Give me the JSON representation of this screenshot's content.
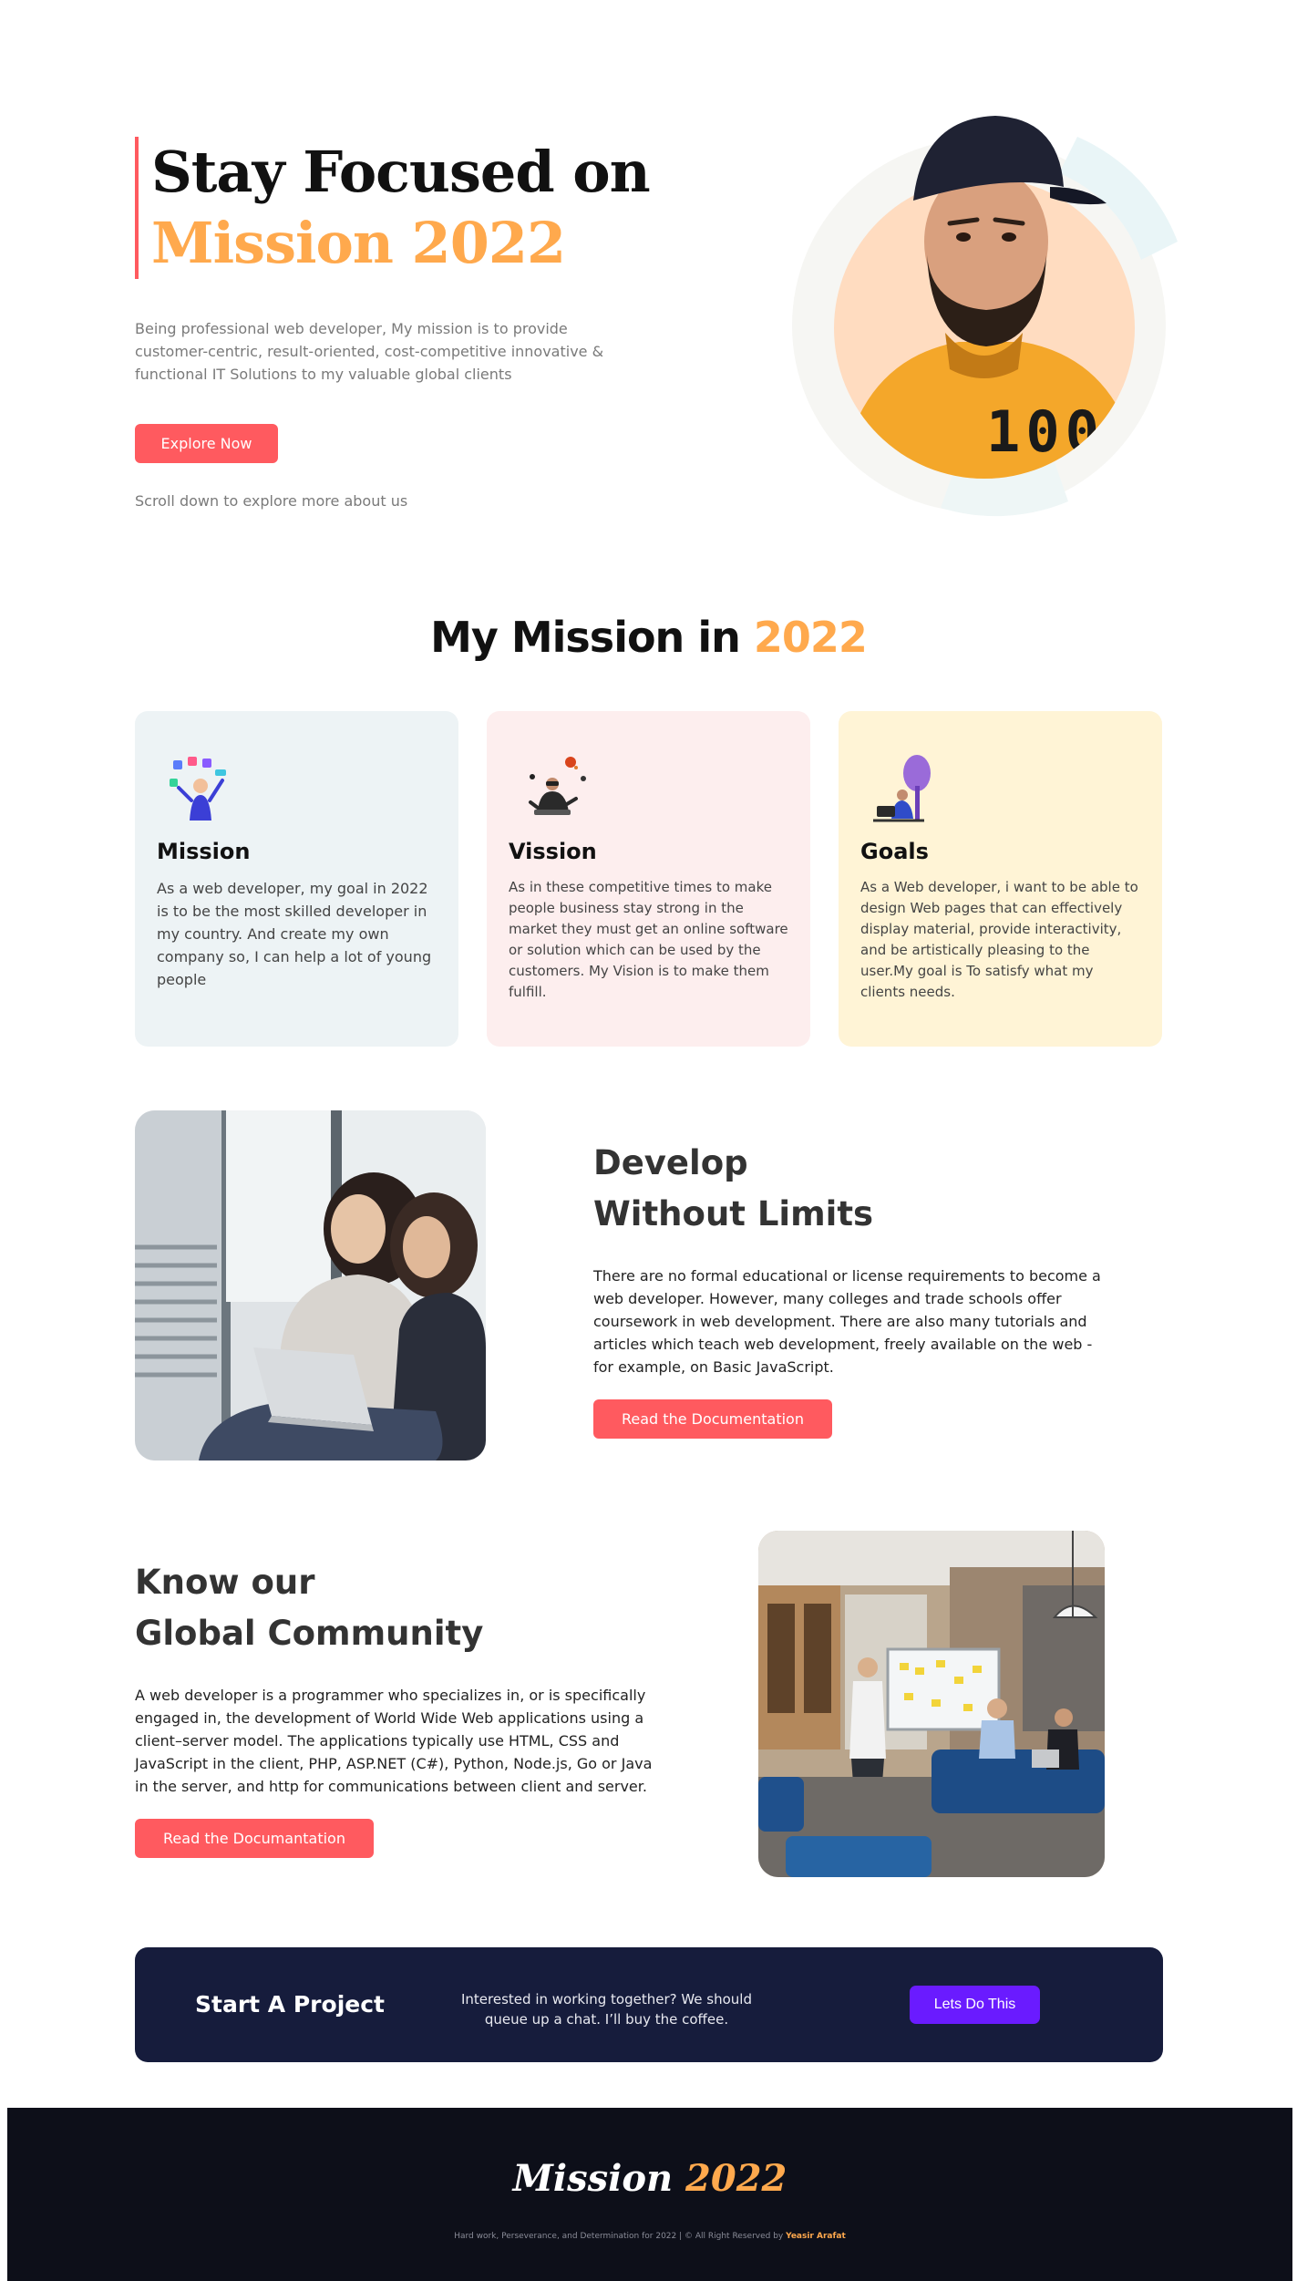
{
  "hero": {
    "title_line1": "Stay Focused on",
    "title_line2": "Mission 2022",
    "description": "Being professional web developer, My mission is to provide customer-centric, result-oriented, cost-competitive innovative & functional IT Solutions to my valuable global clients",
    "cta_label": "Explore Now",
    "scroll_hint": "Scroll down to explore more about us",
    "shirt_text": "100"
  },
  "mission_section": {
    "title_prefix": "My Mission in",
    "title_accent": "2022",
    "cards": [
      {
        "title": "Mission",
        "text": "As a web developer, my goal in 2022 is to be the most skilled developer in my country. And create my own company so, I can help a lot of young people",
        "icon": "juggling-apps-illustration"
      },
      {
        "title": "Vission",
        "text": "As in these competitive times to make people business stay strong in the market they must get an online software or solution which can be used by the customers. My Vision is to make them fulfill.",
        "icon": "vr-headset-illustration"
      },
      {
        "title": "Goals",
        "text": "As a Web developer, i want to be able to design Web pages that can effectively display material, provide interactivity, and be artistically pleasing to the user.My goal is To satisfy what my clients needs.",
        "icon": "laptop-tree-illustration"
      }
    ]
  },
  "develop": {
    "title_line1": "Develop",
    "title_line2": "Without Limits",
    "text": "There are no formal educational or license requirements to become a web developer. However, many colleges and trade schools offer coursework in web development. There are also many tutorials and articles which teach web development, freely available on the web - for example, on Basic JavaScript.",
    "button_label": "Read the Documentation"
  },
  "community": {
    "title_line1": "Know our",
    "title_line2": "Global Community",
    "text": "A web developer is a programmer who specializes in, or is specifically engaged in, the development of World Wide Web applications using a client–server model. The applications typically use HTML, CSS and JavaScript in the client, PHP, ASP.NET (C#), Python, Node.js, Go or Java in the server, and http for communications between client and server.",
    "button_label": "Read the Documantation"
  },
  "cta": {
    "title": "Start A Project",
    "text": "Interested in working together? We should queue up a chat. I’ll buy the coffee.",
    "button_label": "Lets Do This"
  },
  "footer": {
    "logo_main": "Mission",
    "logo_accent": "2022",
    "copyright": "Hard work, Perseverance, and Determination for 2022 | © All Right Reserved by",
    "author": "Yeasir Arafat"
  },
  "colors": {
    "accent_red": "#ff5a5f",
    "accent_orange": "#ffa94d",
    "cta_bg": "#161c3c",
    "cta_button": "#6a1bff",
    "footer_bg": "#0d0f19"
  }
}
